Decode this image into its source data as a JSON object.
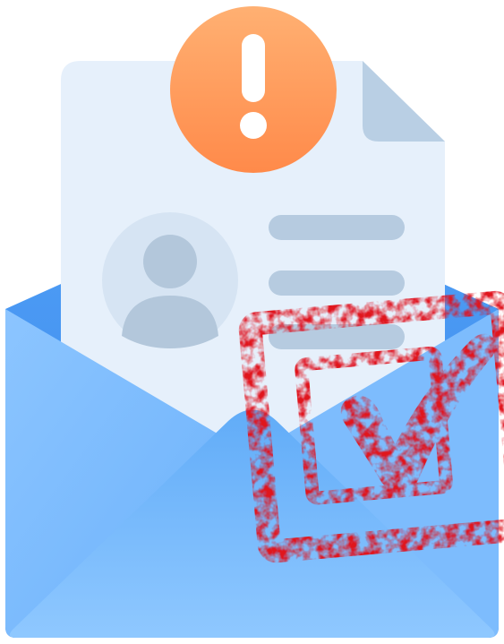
{
  "illustration": {
    "subject": "approved-document-in-envelope",
    "icons": [
      "envelope-icon",
      "document-icon",
      "avatar-icon",
      "alert-icon",
      "approval-stamp-icon",
      "checkmark-icon"
    ],
    "colors": {
      "envelope_light": "#8ec7ff",
      "envelope_mid": "#5aa9f6",
      "envelope_dark": "#3f8ef0",
      "document": "#e6f0fb",
      "document_fold": "#b9cfe4",
      "document_lines": "#b6cbe0",
      "avatar_bg": "#d6e4f3",
      "avatar_figure": "#b3c7db",
      "alert_top": "#ffb072",
      "alert_bottom": "#ff8f4c",
      "alert_mark": "#ffffff",
      "stamp_red": "#e0131f"
    }
  }
}
